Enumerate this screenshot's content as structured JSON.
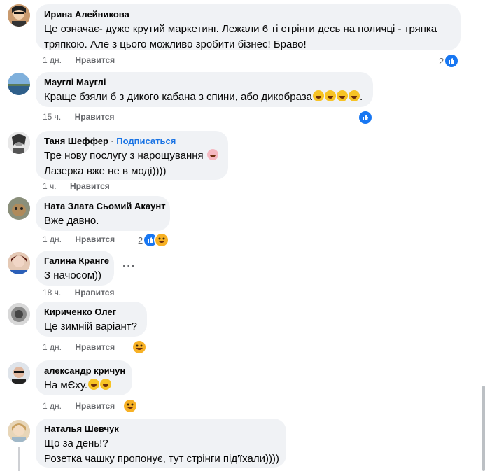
{
  "comments": [
    {
      "author": "Ирина Алейникова",
      "lines": [
        "Це означає- дуже крутий маркетинг. Лежали 6 ті стрінги десь на поличці - тряпка",
        "тряпкою. Але з цього можливо зробити бізнес! Браво!"
      ],
      "time": "1 дн.",
      "like": "Нравится",
      "reaction_count": "2"
    },
    {
      "author": "Мауглі Мауглі",
      "lines": [
        "Краще бзяли б з дикого кабана з спини, або дикобраза"
      ],
      "time": "15 ч.",
      "like": "Нравится",
      "reaction_count": ""
    },
    {
      "author": "Таня Шеффер",
      "follow": "Подписаться",
      "lines": [
        "Тре нову послугу з нарощування",
        "Лазерка вже не в моді))))"
      ],
      "time": "1 ч.",
      "like": "Нравится",
      "reaction_count": ""
    },
    {
      "author": "Ната Злата Сьомий Акаунт",
      "lines": [
        "Вже давно."
      ],
      "time": "1 дн.",
      "like": "Нравится",
      "reaction_count": "2"
    },
    {
      "author": "Галина Кранге",
      "lines": [
        "З начосом))"
      ],
      "time": "18 ч.",
      "like": "Нравится",
      "reaction_count": ""
    },
    {
      "author": "Кириченко Олег",
      "lines": [
        "Це зимній варіант?"
      ],
      "time": "1 дн.",
      "like": "Нравится",
      "reaction_count": ""
    },
    {
      "author": "александр кричун",
      "lines": [
        "На мЄху."
      ],
      "time": "1 дн.",
      "like": "Нравится",
      "reaction_count": ""
    },
    {
      "author": "Наталья Шевчук",
      "lines": [
        "Що за день!?",
        "Розетка чашку пропонує, тут стрінги під'їхали))))"
      ],
      "time": "",
      "like": "",
      "reaction_count": ""
    }
  ],
  "menu_dots": "···",
  "colors": {
    "bubble": "#f0f2f5",
    "accent": "#1877f2",
    "meta": "#65676b"
  },
  "icons": [
    "like-reaction-icon",
    "haha-reaction-icon",
    "laughing-emoji-icon",
    "more-options-icon"
  ]
}
